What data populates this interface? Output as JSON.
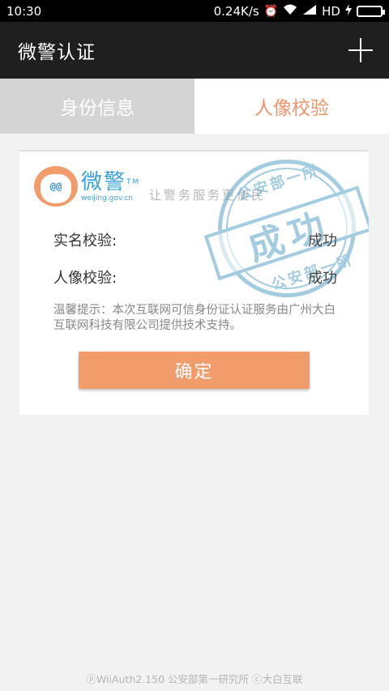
{
  "statusbar": {
    "time": "10:30",
    "speed": "0.24K/s",
    "network": "HD",
    "icons": [
      "alarm-icon",
      "wifi-icon",
      "signal-icon",
      "charging-icon",
      "battery-icon"
    ]
  },
  "header": {
    "title": "微警认证"
  },
  "tabs": [
    {
      "label": "身份信息",
      "active": false
    },
    {
      "label": "人像校验",
      "active": true
    }
  ],
  "card": {
    "logo_cn": "微警",
    "logo_tm": "TM",
    "logo_url": "weijing.gov.cn",
    "logo_face": "@@",
    "tech_support": "让警务服务更便民",
    "stamp_main": "成功",
    "stamp_top": "公安部一所",
    "stamp_bottom": "公安部一所",
    "rows": [
      {
        "label": "实名校验:",
        "value": "成功"
      },
      {
        "label": "人像校验:",
        "value": "成功"
      }
    ],
    "notice": "温馨提示：本次互联网可信身份证认证服务由广州大白互联网科技有限公司提供技术支持。",
    "confirm_label": "确定"
  },
  "footer": {
    "text": "ⓟWiiAuth2.150  公安部第一研究所  ⓒ大白互联"
  },
  "colors": {
    "accent": "#f39c6b",
    "tab_active_text": "#f0956b",
    "tab_inactive_bg": "#d4d4d4",
    "titlebar_bg": "#1f1f1f",
    "stamp": "#5ba3c7"
  }
}
